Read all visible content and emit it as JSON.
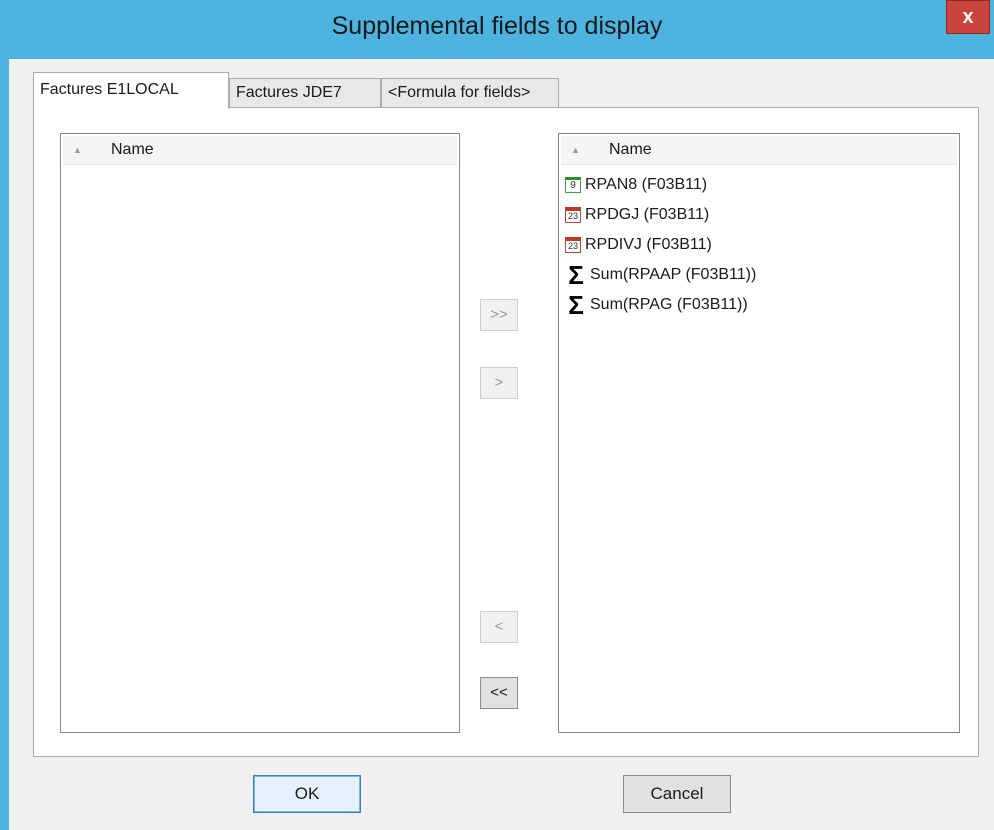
{
  "window": {
    "title": "Supplemental fields to display",
    "close_label": "x"
  },
  "tabs": [
    {
      "label": "Factures E1LOCAL",
      "active": true
    },
    {
      "label": "Factures JDE7",
      "active": false
    },
    {
      "label": "<Formula for fields>",
      "active": false
    }
  ],
  "available_list": {
    "header": "Name",
    "items": []
  },
  "selected_list": {
    "header": "Name",
    "items": [
      {
        "icon": "numeric-field-icon",
        "icon_glyph": "9",
        "label": "RPAN8 (F03B11)"
      },
      {
        "icon": "date-field-icon",
        "icon_glyph": "23",
        "label": "RPDGJ (F03B11)"
      },
      {
        "icon": "date-field-icon",
        "icon_glyph": "23",
        "label": "RPDIVJ (F03B11)"
      },
      {
        "icon": "sum-icon",
        "icon_glyph": "Σ",
        "label": "Sum(RPAAP (F03B11))"
      },
      {
        "icon": "sum-icon",
        "icon_glyph": "Σ",
        "label": "Sum(RPAG (F03B11))"
      }
    ]
  },
  "transfer_buttons": {
    "add_all": {
      "label": ">>",
      "enabled": false
    },
    "add_one": {
      "label": ">",
      "enabled": false
    },
    "remove_one": {
      "label": "<",
      "enabled": false
    },
    "remove_all": {
      "label": "<<",
      "enabled": true
    }
  },
  "buttons": {
    "ok": "OK",
    "cancel": "Cancel"
  }
}
